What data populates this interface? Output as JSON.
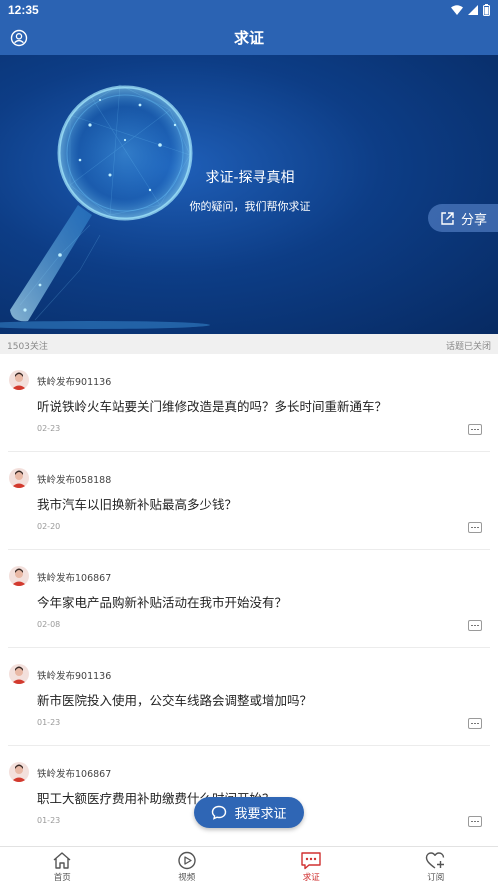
{
  "status": {
    "time": "12:35"
  },
  "header": {
    "title": "求证",
    "user_icon": "user-circle-icon"
  },
  "banner": {
    "title": "求证-探寻真相",
    "subtitle": "你的疑问，我们帮你求证",
    "share_label": "分享"
  },
  "info": {
    "followers": "1503关注",
    "topic_status": "话题已关闭"
  },
  "posts": [
    {
      "author": "铁岭发布901136",
      "question": "听说铁岭火车站要关门维修改造是真的吗？多长时间重新通车？",
      "date": "02-23"
    },
    {
      "author": "铁岭发布058188",
      "question": "我市汽车以旧换新补贴最高多少钱？",
      "date": "02-20"
    },
    {
      "author": "铁岭发布106867",
      "question": "今年家电产品购新补贴活动在我市开始没有？",
      "date": "02-08"
    },
    {
      "author": "铁岭发布901136",
      "question": "新市医院投入使用，公交车线路会调整或增加吗？",
      "date": "01-23"
    },
    {
      "author": "铁岭发布106867",
      "question": "职工大额医疗费用补助缴费什么时间开始？",
      "date": "01-23"
    }
  ],
  "fab": {
    "label": "我要求证"
  },
  "tabs": [
    {
      "label": "首页",
      "icon": "home-icon"
    },
    {
      "label": "视频",
      "icon": "video-play-icon"
    },
    {
      "label": "求证",
      "icon": "chat-bubble-icon",
      "active": true
    },
    {
      "label": "订阅",
      "icon": "heart-plus-icon"
    }
  ],
  "colors": {
    "primary": "#2b63b3",
    "active_tab": "#d03030"
  }
}
